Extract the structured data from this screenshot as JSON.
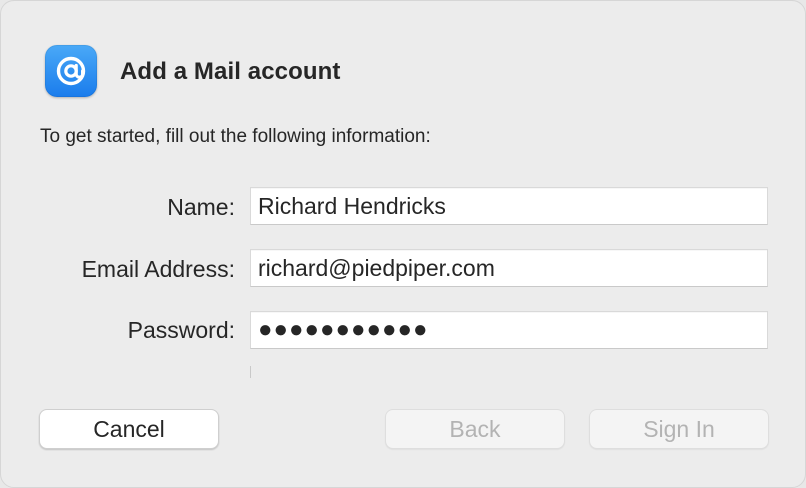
{
  "dialog": {
    "title": "Add a Mail account",
    "subtitle": "To get started, fill out the following information:",
    "app_icon": "mail-at-sign-icon",
    "colors": {
      "icon_gradient_top": "#4aa9f7",
      "icon_gradient_bottom": "#1a7cec",
      "disabled_text": "#b3b3b3"
    }
  },
  "form": {
    "name": {
      "label": "Name:",
      "value": "Richard Hendricks"
    },
    "email": {
      "label": "Email Address:",
      "value": "richard@piedpiper.com"
    },
    "password": {
      "label": "Password:",
      "value": "●●●●●●●●●●●"
    }
  },
  "buttons": {
    "cancel": {
      "label": "Cancel",
      "enabled": true
    },
    "back": {
      "label": "Back",
      "enabled": false
    },
    "sign_in": {
      "label": "Sign In",
      "enabled": false
    }
  }
}
